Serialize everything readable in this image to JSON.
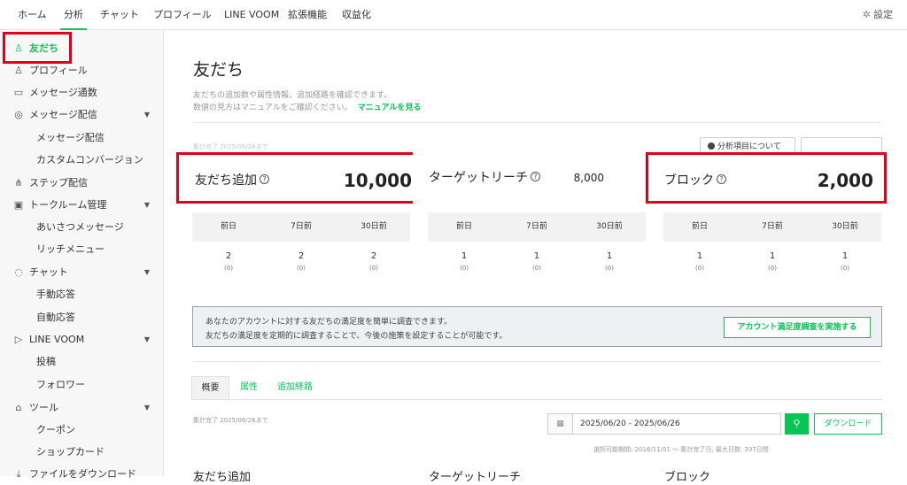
{
  "topnav": {
    "tabs": [
      "ホーム",
      "分析",
      "チャット",
      "プロフィール",
      "LINE VOOM",
      "拡張機能",
      "収益化"
    ],
    "active": "分析",
    "settings_label": "設定",
    "settings_icon": "gear-icon"
  },
  "sidebar": {
    "items": [
      {
        "label": "友だち",
        "icon": "person-add-icon",
        "active": true
      },
      {
        "label": "プロフィール",
        "icon": "profile-icon"
      },
      {
        "label": "メッセージ通数",
        "icon": "inbox-icon"
      },
      {
        "label": "メッセージ配信",
        "icon": "broadcast-icon",
        "caret": true
      },
      {
        "label": "メッセージ配信",
        "sub": true
      },
      {
        "label": "カスタムコンバージョン",
        "sub": true
      },
      {
        "label": "ステップ配信",
        "icon": "hierarchy-icon"
      },
      {
        "label": "トークルーム管理",
        "icon": "room-icon",
        "caret": true
      },
      {
        "label": "あいさつメッセージ",
        "sub": true
      },
      {
        "label": "リッチメニュー",
        "sub": true
      },
      {
        "label": "チャット",
        "icon": "chat-icon",
        "caret": true
      },
      {
        "label": "手動応答",
        "sub": true
      },
      {
        "label": "自動応答",
        "sub": true
      },
      {
        "label": "LINE VOOM",
        "icon": "play-icon",
        "caret": true
      },
      {
        "label": "投稿",
        "sub": true
      },
      {
        "label": "フォロワー",
        "sub": true
      },
      {
        "label": "ツール",
        "icon": "store-icon",
        "caret": true
      },
      {
        "label": "クーポン",
        "sub": true
      },
      {
        "label": "ショップカード",
        "sub": true
      },
      {
        "label": "ファイルをダウンロード",
        "icon": "download-icon"
      }
    ]
  },
  "main": {
    "title": "友だち",
    "desc1": "友だちの追加数や属性情報、追加経路を確認できます。",
    "desc2": "数値の見方はマニュアルをご確認ください。",
    "manual_link": "マニュアルを見る",
    "tiny_note": "集計完了 2025/06/26まで",
    "analysis_button": "分析項目について",
    "stats": [
      {
        "label": "友だち追加",
        "value": "10,000"
      },
      {
        "label": "ターゲットリーチ",
        "value": "8,000"
      },
      {
        "label": "ブロック",
        "value": "2,000"
      }
    ],
    "period_headers": [
      "前日",
      "7日前",
      "30日前"
    ],
    "period_rows": [
      [
        {
          "n": "2",
          "s": "(0)"
        },
        {
          "n": "2",
          "s": "(0)"
        },
        {
          "n": "2",
          "s": "(0)"
        }
      ],
      [
        {
          "n": "1",
          "s": "(0)"
        },
        {
          "n": "1",
          "s": "(0)"
        },
        {
          "n": "1",
          "s": "(0)"
        }
      ],
      [
        {
          "n": "1",
          "s": "(0)"
        },
        {
          "n": "1",
          "s": "(0)"
        },
        {
          "n": "1",
          "s": "(0)"
        }
      ]
    ],
    "survey": {
      "line1": "あなたのアカウントに対する友だちの満足度を簡単に調査できます。",
      "line2": "友だちの満足度を定期的に調査することで、今後の施策を設定することが可能です。",
      "button": "アカウント満足度調査を実施する"
    },
    "subtabs": [
      "概要",
      "属性",
      "追加経路"
    ],
    "agg_note": "集計完了 2025/06/26まで",
    "date_range": "2025/06/20 - 2025/06/26",
    "download": "ダウンロード",
    "period_note": "選択可能期間: 2016/11/01 〜 集計完了日, 最大日数: 397日間",
    "section_heads": [
      "友だち追加",
      "ターゲットリーチ",
      "ブロック"
    ]
  },
  "colors": {
    "accent": "#06c755",
    "highlight": "#e0001a"
  }
}
